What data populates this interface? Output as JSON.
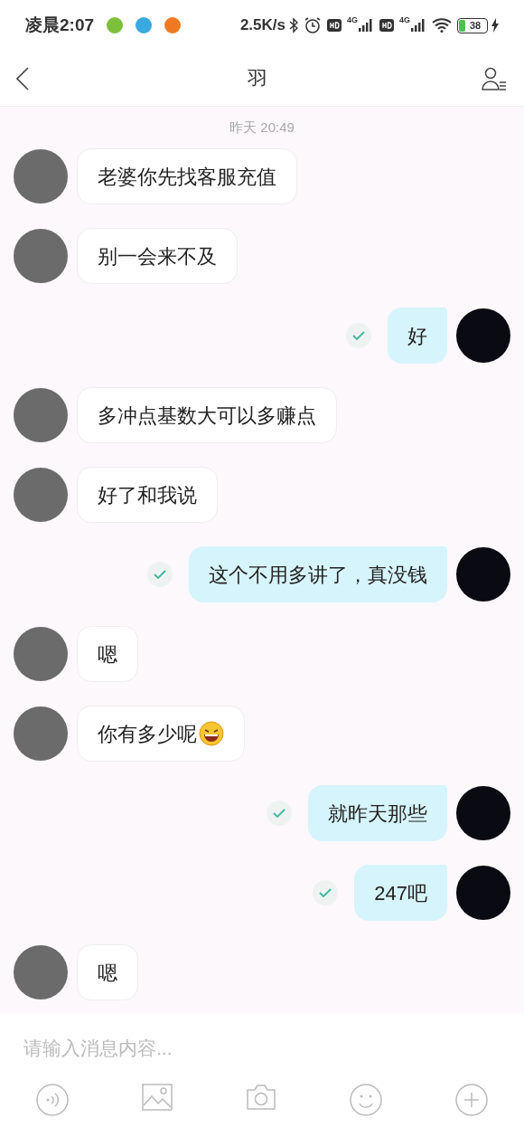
{
  "status_bar": {
    "time": "凌晨2:07",
    "speed": "2.5K/s",
    "battery": "38",
    "network_labels": [
      "4G",
      "4G"
    ]
  },
  "header": {
    "title": "羽"
  },
  "timestamp": "昨天 20:49",
  "messages": [
    {
      "kind": "incoming",
      "text": "老婆你先找客服充值"
    },
    {
      "kind": "incoming",
      "text": "别一会来不及"
    },
    {
      "kind": "outgoing",
      "text": "好",
      "read": true
    },
    {
      "kind": "incoming",
      "text": "多冲点基数大可以多赚点"
    },
    {
      "kind": "incoming",
      "text": "好了和我说"
    },
    {
      "kind": "outgoing",
      "text": "这个不用多讲了，真没钱",
      "read": true
    },
    {
      "kind": "incoming",
      "text": "嗯"
    },
    {
      "kind": "incoming",
      "text": "你有多少呢",
      "emoji": true
    },
    {
      "kind": "outgoing",
      "text": "就昨天那些",
      "read": true
    },
    {
      "kind": "outgoing",
      "text": "247吧",
      "read": true
    },
    {
      "kind": "incoming",
      "text": "嗯"
    }
  ],
  "composer": {
    "placeholder": "请输入消息内容..."
  }
}
